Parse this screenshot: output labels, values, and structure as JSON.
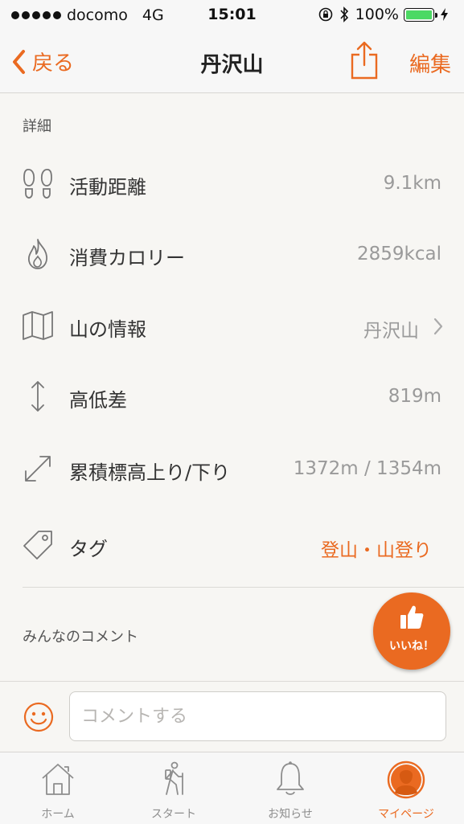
{
  "status_bar": {
    "carrier": "docomo",
    "network": "4G",
    "time": "15:01",
    "battery": "100%",
    "battery_level": 1.0
  },
  "nav": {
    "back_label": "戻る",
    "title": "丹沢山",
    "edit_label": "編集",
    "share_icon": "share-icon"
  },
  "details": {
    "section_title": "詳細",
    "rows": [
      {
        "icon": "footprints-icon",
        "label": "活動距離",
        "value": "9.1km"
      },
      {
        "icon": "flame-icon",
        "label": "消費カロリー",
        "value": "2859kcal"
      },
      {
        "icon": "map-icon",
        "label": "山の情報",
        "value": "丹沢山"
      },
      {
        "icon": "vertical-arrows-icon",
        "label": "高低差",
        "value": "819m"
      },
      {
        "icon": "diagonal-arrows-icon",
        "label": "累積標高上り/下り",
        "value": "1372m / 1354m"
      },
      {
        "icon": "tag-icon",
        "label": "タグ",
        "value": "登山・山登り"
      }
    ]
  },
  "comments": {
    "section_title": "みんなのコメント",
    "input_placeholder": "コメントする"
  },
  "like_button": {
    "label": "いいね！"
  },
  "tabs": [
    {
      "icon": "home-icon",
      "label": "ホーム",
      "active": false
    },
    {
      "icon": "hiker-icon",
      "label": "スタート",
      "active": false
    },
    {
      "icon": "bell-icon",
      "label": "お知らせ",
      "active": false
    },
    {
      "icon": "person-icon",
      "label": "マイページ",
      "active": true
    }
  ],
  "colors": {
    "accent": "#ea6a21",
    "background": "#f7f6f3",
    "value_gray": "#9a9a9a",
    "battery_green": "#4cd964"
  }
}
